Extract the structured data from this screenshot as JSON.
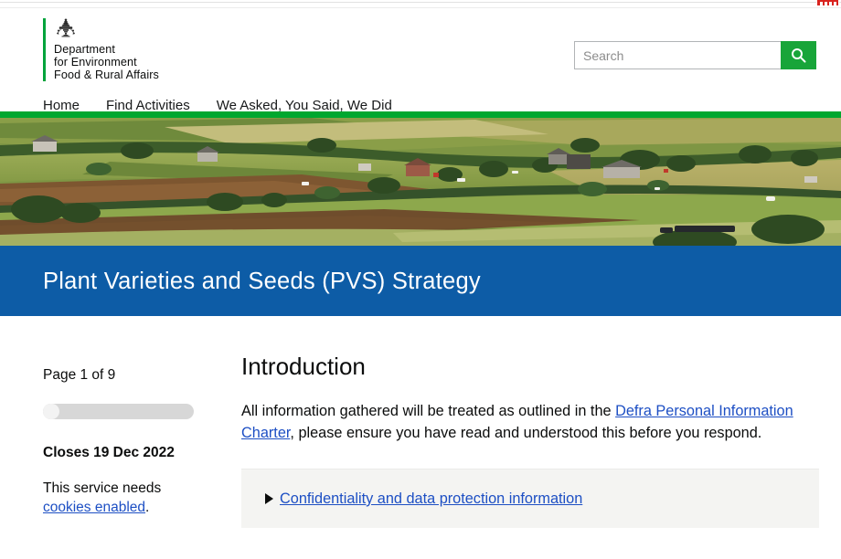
{
  "browser": {
    "badge_icon": "red-notification-badge"
  },
  "header": {
    "brand": {
      "crest_icon": "royal-crest-icon",
      "line1": "Department",
      "line2": "for Environment",
      "line3": "Food & Rural Affairs",
      "accent_color": "#00a33b"
    },
    "search": {
      "placeholder": "Search",
      "value": "",
      "button_icon": "search-icon",
      "button_color": "#18a539"
    },
    "nav": [
      {
        "label": "Home"
      },
      {
        "label": "Find Activities"
      },
      {
        "label": "We Asked, You Said, We Did"
      }
    ]
  },
  "hero": {
    "image_alt": "rural-countryside-fields-banner",
    "rule_color": "#00a72f"
  },
  "title_band": {
    "title": "Plant Varieties and Seeds (PVS) Strategy",
    "background_color": "#0d5ca6"
  },
  "sidebar": {
    "page_count": "Page 1 of 9",
    "progress_percent": 11,
    "closes": "Closes 19 Dec 2022",
    "cookie_text_before": "This service needs ",
    "cookie_link": "cookies enabled",
    "cookie_text_after": "."
  },
  "content": {
    "heading": "Introduction",
    "paragraph_before": "All information gathered will be treated as outlined in the ",
    "paragraph_link": "Defra Personal Information Charter",
    "paragraph_after": ", please ensure you have read and understood this before you respond.",
    "details": {
      "marker_icon": "triangle-right-icon",
      "summary": "Confidentiality and data protection information",
      "expanded": false
    }
  },
  "colors": {
    "link": "#1d4fc4",
    "text": "#0b0c0c"
  }
}
